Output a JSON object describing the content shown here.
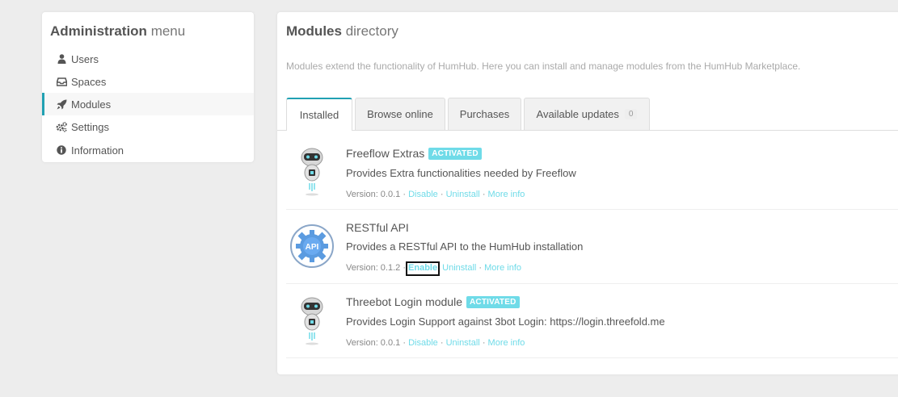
{
  "admin_menu": {
    "title_bold": "Administration",
    "title_light": "menu",
    "items": [
      {
        "label": "Users",
        "icon": "user-icon"
      },
      {
        "label": "Spaces",
        "icon": "inbox-icon"
      },
      {
        "label": "Modules",
        "icon": "rocket-icon",
        "active": true
      },
      {
        "label": "Settings",
        "icon": "gears-icon"
      },
      {
        "label": "Information",
        "icon": "info-circle-icon"
      }
    ]
  },
  "modules": {
    "title_bold": "Modules",
    "title_light": "directory",
    "description": "Modules extend the functionality of HumHub. Here you can install and manage modules from the HumHub Marketplace.",
    "tabs": [
      {
        "label": "Installed",
        "active": true
      },
      {
        "label": "Browse online"
      },
      {
        "label": "Purchases"
      },
      {
        "label": "Available updates",
        "badge": "0"
      }
    ],
    "list": [
      {
        "name": "Freeflow Extras",
        "status": "ACTIVATED",
        "description": "Provides Extra functionalities needed by Freeflow",
        "version": "Version: 0.0.1",
        "action": "Disable",
        "uninstall": "Uninstall",
        "more": "More info",
        "icon": "robot-icon"
      },
      {
        "name": "RESTful API",
        "status": "",
        "description": "Provides a RESTful API to the HumHub installation",
        "version": "Version: 0.1.2",
        "action": "Enable",
        "uninstall": "Uninstall",
        "more": "More info",
        "icon": "api-gear-icon"
      },
      {
        "name": "Threebot Login module",
        "status": "ACTIVATED",
        "description": "Provides Login Support against 3bot Login: https://login.threefold.me",
        "version": "Version: 0.0.1",
        "action": "Disable",
        "uninstall": "Uninstall",
        "more": "More info",
        "icon": "robot-icon"
      }
    ],
    "separator": "·"
  },
  "colors": {
    "accent": "#21a1b3",
    "link": "#6fdbe8",
    "label_bg": "#6fdbe8",
    "background": "#ededed"
  }
}
